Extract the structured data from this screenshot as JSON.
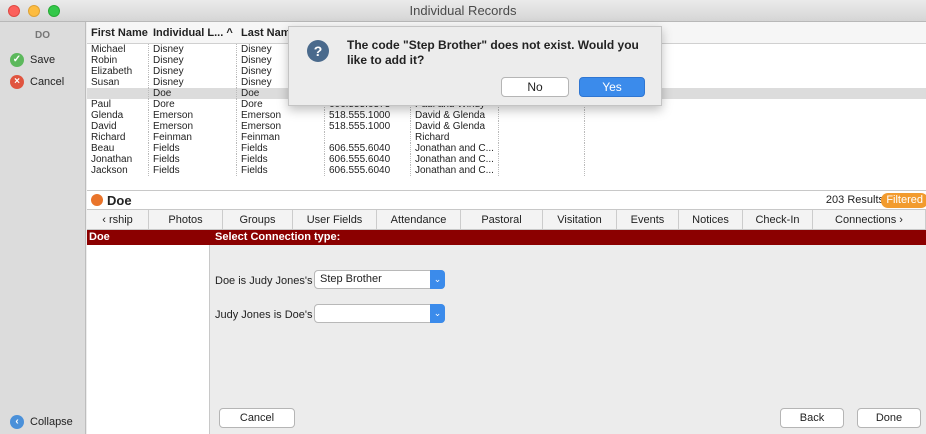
{
  "window": {
    "title": "Individual Records"
  },
  "sidebar": {
    "initials": "DO",
    "save_label": "Save",
    "cancel_label": "Cancel",
    "collapse_label": "Collapse"
  },
  "grid": {
    "headers": [
      "First Name",
      "Individual L...",
      "Last Nam",
      "",
      "",
      ""
    ],
    "sort_indicator": "^",
    "rows": [
      [
        "Michael",
        "Disney",
        "Disney",
        "",
        "",
        ""
      ],
      [
        "Robin",
        "Disney",
        "Disney",
        "",
        "",
        ""
      ],
      [
        "Elizabeth",
        "Disney",
        "Disney",
        "",
        "",
        ""
      ],
      [
        "Susan",
        "Disney",
        "Disney",
        "",
        "",
        ""
      ],
      [
        "",
        "Doe",
        "Doe",
        "",
        "",
        ""
      ],
      [
        "Paul",
        "Dore",
        "Dore",
        "606.555.6373",
        "Paul and Windy",
        ""
      ],
      [
        "Glenda",
        "Emerson",
        "Emerson",
        "518.555.1000",
        "David & Glenda",
        ""
      ],
      [
        "David",
        "Emerson",
        "Emerson",
        "518.555.1000",
        "David & Glenda",
        ""
      ],
      [
        "Richard",
        "Feinman",
        "Feinman",
        "",
        "Richard",
        ""
      ],
      [
        "Beau",
        "Fields",
        "Fields",
        "606.555.6040",
        "Jonathan and C...",
        ""
      ],
      [
        "Jonathan",
        "Fields",
        "Fields",
        "606.555.6040",
        "Jonathan and C...",
        ""
      ],
      [
        "Jackson",
        "Fields",
        "Fields",
        "606.555.6040",
        "Jonathan and C...",
        ""
      ]
    ],
    "selected_row": 4
  },
  "record": {
    "name": "Doe",
    "results": "203 Results",
    "filtered": "Filtered"
  },
  "tabs": [
    "rship",
    "Photos",
    "Groups",
    "User Fields",
    "Attendance",
    "Pastoral",
    "Visitation",
    "Events",
    "Notices",
    "Check-In",
    "Connections"
  ],
  "connection": {
    "left_header": "Doe",
    "header": "Select Connection type:",
    "label1": "Doe is Judy Jones's",
    "value1": "Step Brother",
    "label2": "Judy Jones is Doe's",
    "value2": "",
    "cancel": "Cancel",
    "back": "Back",
    "done": "Done"
  },
  "dialog": {
    "message": "The code \"Step Brother\" does not exist. Would you like to add it?",
    "no": "No",
    "yes": "Yes"
  }
}
